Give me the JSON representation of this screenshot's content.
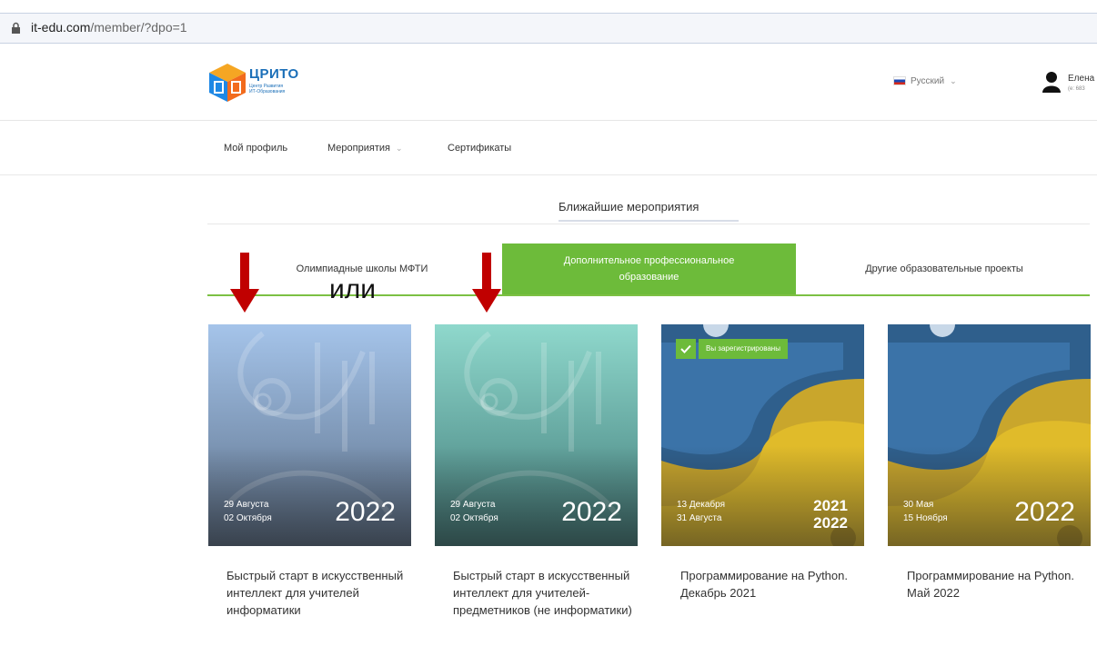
{
  "browser": {
    "domain": "it-edu.com",
    "path": "/member/?dpo=1"
  },
  "header": {
    "brand": "ЦРИТО",
    "tagline1": "Центр Развития",
    "tagline2": "ИТ-Образования",
    "language": "Русский",
    "user_name": "Елена",
    "user_sub": "(e: 683"
  },
  "nav": {
    "profile": "Мой профиль",
    "events": "Мероприятия",
    "certificates": "Сертификаты"
  },
  "section": {
    "title": "Ближайшие мероприятия"
  },
  "tabs": [
    {
      "label": "Олимпиадные школы МФТИ"
    },
    {
      "label": "Дополнительное профессиональное образование"
    },
    {
      "label": "Другие образовательные проекты"
    }
  ],
  "annotation": {
    "or_text": "или"
  },
  "cards": [
    {
      "date1": "29 Августа",
      "date2": "02 Октября",
      "year": "2022",
      "title": "Быстрый старт в искусственный интеллект для учителей информатики"
    },
    {
      "date1": "29 Августа",
      "date2": "02 Октября",
      "year": "2022",
      "title": "Быстрый старт в искусственный интеллект для учителей-предметников (не информатики)"
    },
    {
      "date1": "13 Декабря",
      "date2": "31 Августа",
      "year1": "2021",
      "year2": "2022",
      "badge": "Вы зарегистрированы",
      "title": "Программирование на Python. Декабрь 2021"
    },
    {
      "date1": "30 Мая",
      "date2": "15 Ноября",
      "year": "2022",
      "title": "Программирование на Python. Май 2022"
    }
  ],
  "colors": {
    "accent_green": "#6dbb3a",
    "annotation_red": "#c00000",
    "brand_blue": "#1b6fb8"
  }
}
